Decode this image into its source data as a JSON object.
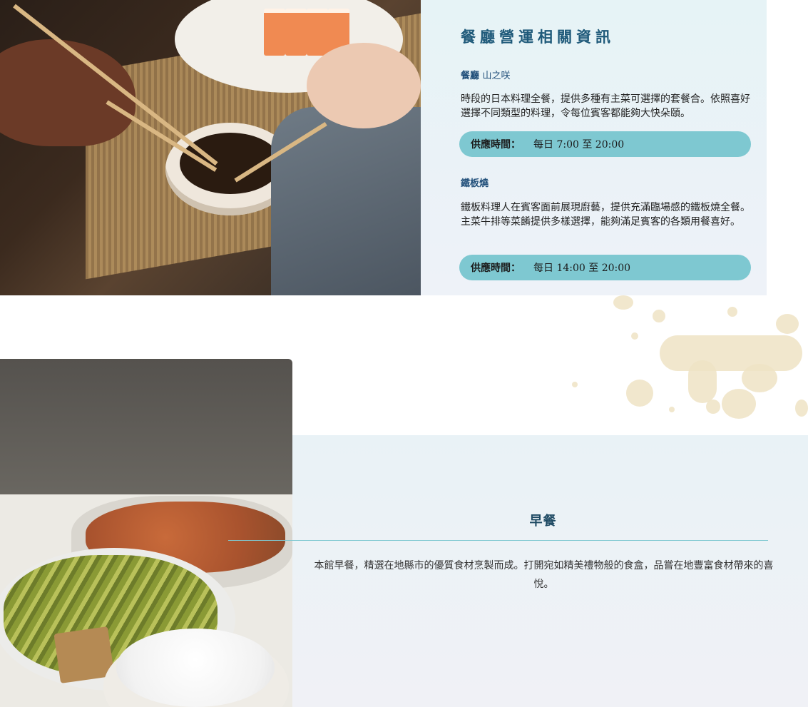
{
  "restaurant_section": {
    "title": "餐廳營運相關資訊",
    "venues": [
      {
        "name": "餐廳",
        "subname": "山之咲",
        "description": "時段的日本料理全餐，提供多種有主菜可選擇的套餐合。依照喜好選擇不同類型的料理，令每位賓客都能夠大快朵頤。",
        "hours_label": "供應時間：",
        "hours_value": "每日 7:00 至 20:00"
      },
      {
        "name": "鐵板燒",
        "subname": "",
        "description": "鐵板料理人在賓客面前展現廚藝，提供充滿臨場感的鐵板燒全餐。主菜牛排等菜餚提供多樣選擇，能夠滿足賓客的各類用餐喜好。",
        "hours_label": "供應時間：",
        "hours_value": "每日 14:00 至 20:00"
      }
    ]
  },
  "breakfast_section": {
    "title": "早餐",
    "description": "本館早餐，精選在地縣市的優質食材烹製而成。打開宛如精美禮物般的食盒，品嘗在地豐富食材帶來的喜悅。"
  },
  "colors": {
    "accent_teal": "#7ec8d1",
    "title_blue": "#1f5a7a",
    "panel_bg": "#e6f3f6",
    "deco_gold": "#efe3c4"
  }
}
